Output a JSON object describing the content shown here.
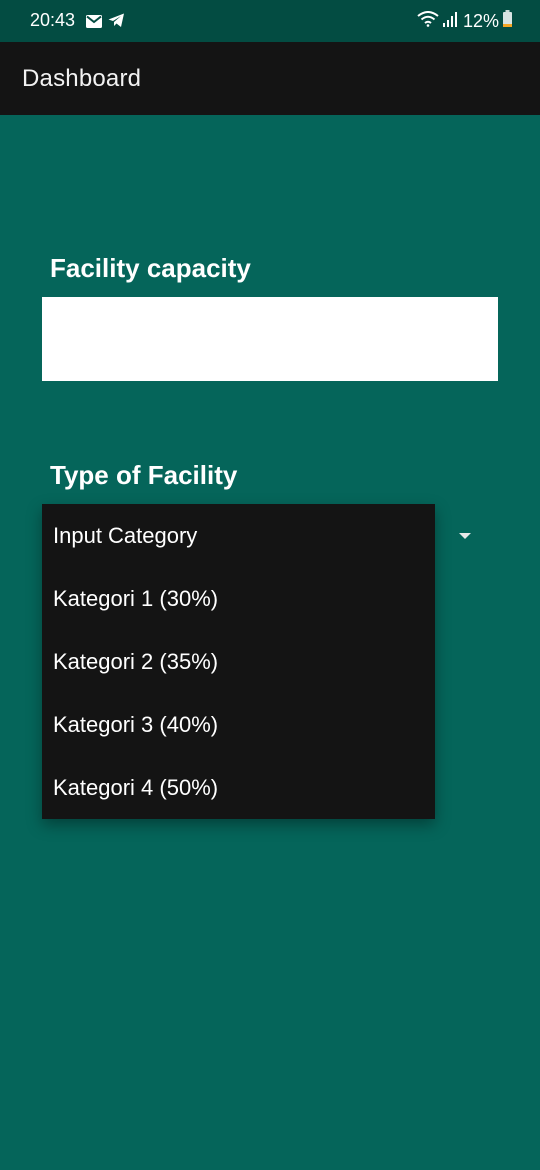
{
  "status_bar": {
    "time": "20:43",
    "left_icons": [
      "mail-icon",
      "telegram-icon"
    ],
    "right_icons": [
      "wifi-icon",
      "signal-icon"
    ],
    "battery_text": "12%",
    "battery_level": 0.12
  },
  "app_bar": {
    "title": "Dashboard"
  },
  "form": {
    "capacity_label": "Facility capacity",
    "capacity_value": "",
    "type_label": "Type of Facility"
  },
  "dropdown": {
    "placeholder": "Input Category",
    "options": [
      "Kategori 1 (30%)",
      "Kategori 2 (35%)",
      "Kategori 3 (40%)",
      "Kategori 4 (50%)"
    ]
  },
  "colors": {
    "background": "#05655a",
    "status_bar": "#034c42",
    "app_bar": "#141414",
    "menu": "#141414"
  }
}
